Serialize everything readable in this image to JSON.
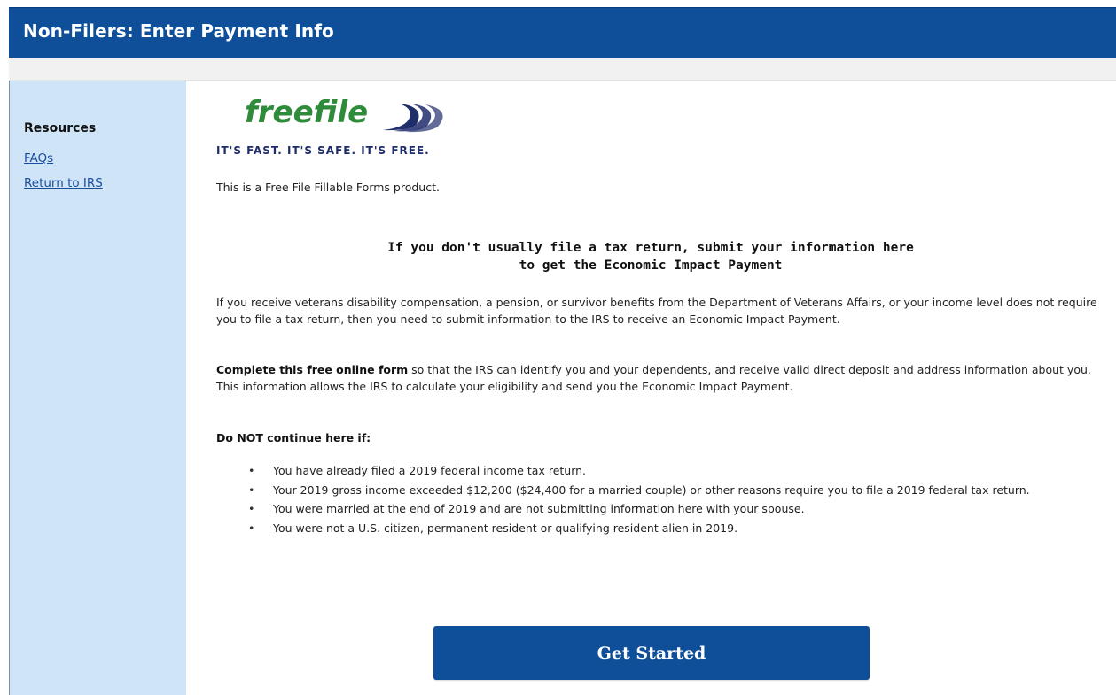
{
  "header": {
    "title": "Non-Filers: Enter Payment Info"
  },
  "sidebar": {
    "heading": "Resources",
    "links": [
      {
        "label": "FAQs"
      },
      {
        "label": "Return to IRS"
      }
    ]
  },
  "logo": {
    "wordmark": "freefile",
    "tagline": "IT'S FAST. IT'S SAFE. IT'S FREE."
  },
  "content": {
    "product_note": "This is a Free File Fillable Forms product.",
    "heading_line1": "If you don't usually file a tax return, submit your information here",
    "heading_line2": "to get the Economic Impact Payment",
    "para1": "If you receive veterans disability compensation, a pension, or survivor benefits from the Department of Veterans Affairs, or your income level does not require you to file a tax return, then you need to submit information to the IRS to receive an Economic Impact Payment.",
    "para2_bold": "Complete this free online form",
    "para2_rest": " so that the IRS can identify you and your dependents, and receive valid direct deposit and address information about you. This information allows the IRS to calculate your eligibility and send you the Economic Impact Payment.",
    "warn_heading": "Do NOT continue here if:",
    "bullets": [
      "You have already filed a 2019 federal income tax return.",
      "Your 2019 gross income exceeded $12,200 ($24,400 for a married couple) or other reasons require you to file a 2019 federal tax return.",
      "You were married at the end of 2019 and are not submitting information here with your spouse.",
      "You were not a U.S. citizen, permanent resident or qualifying resident alien in 2019."
    ],
    "cta_label": "Get Started"
  },
  "colors": {
    "brand_blue": "#0f4f9a",
    "sidebar_bg": "#cfe4f7",
    "logo_green": "#2e8b3a",
    "logo_navy": "#1f2d6b",
    "link": "#1a4fa0"
  }
}
